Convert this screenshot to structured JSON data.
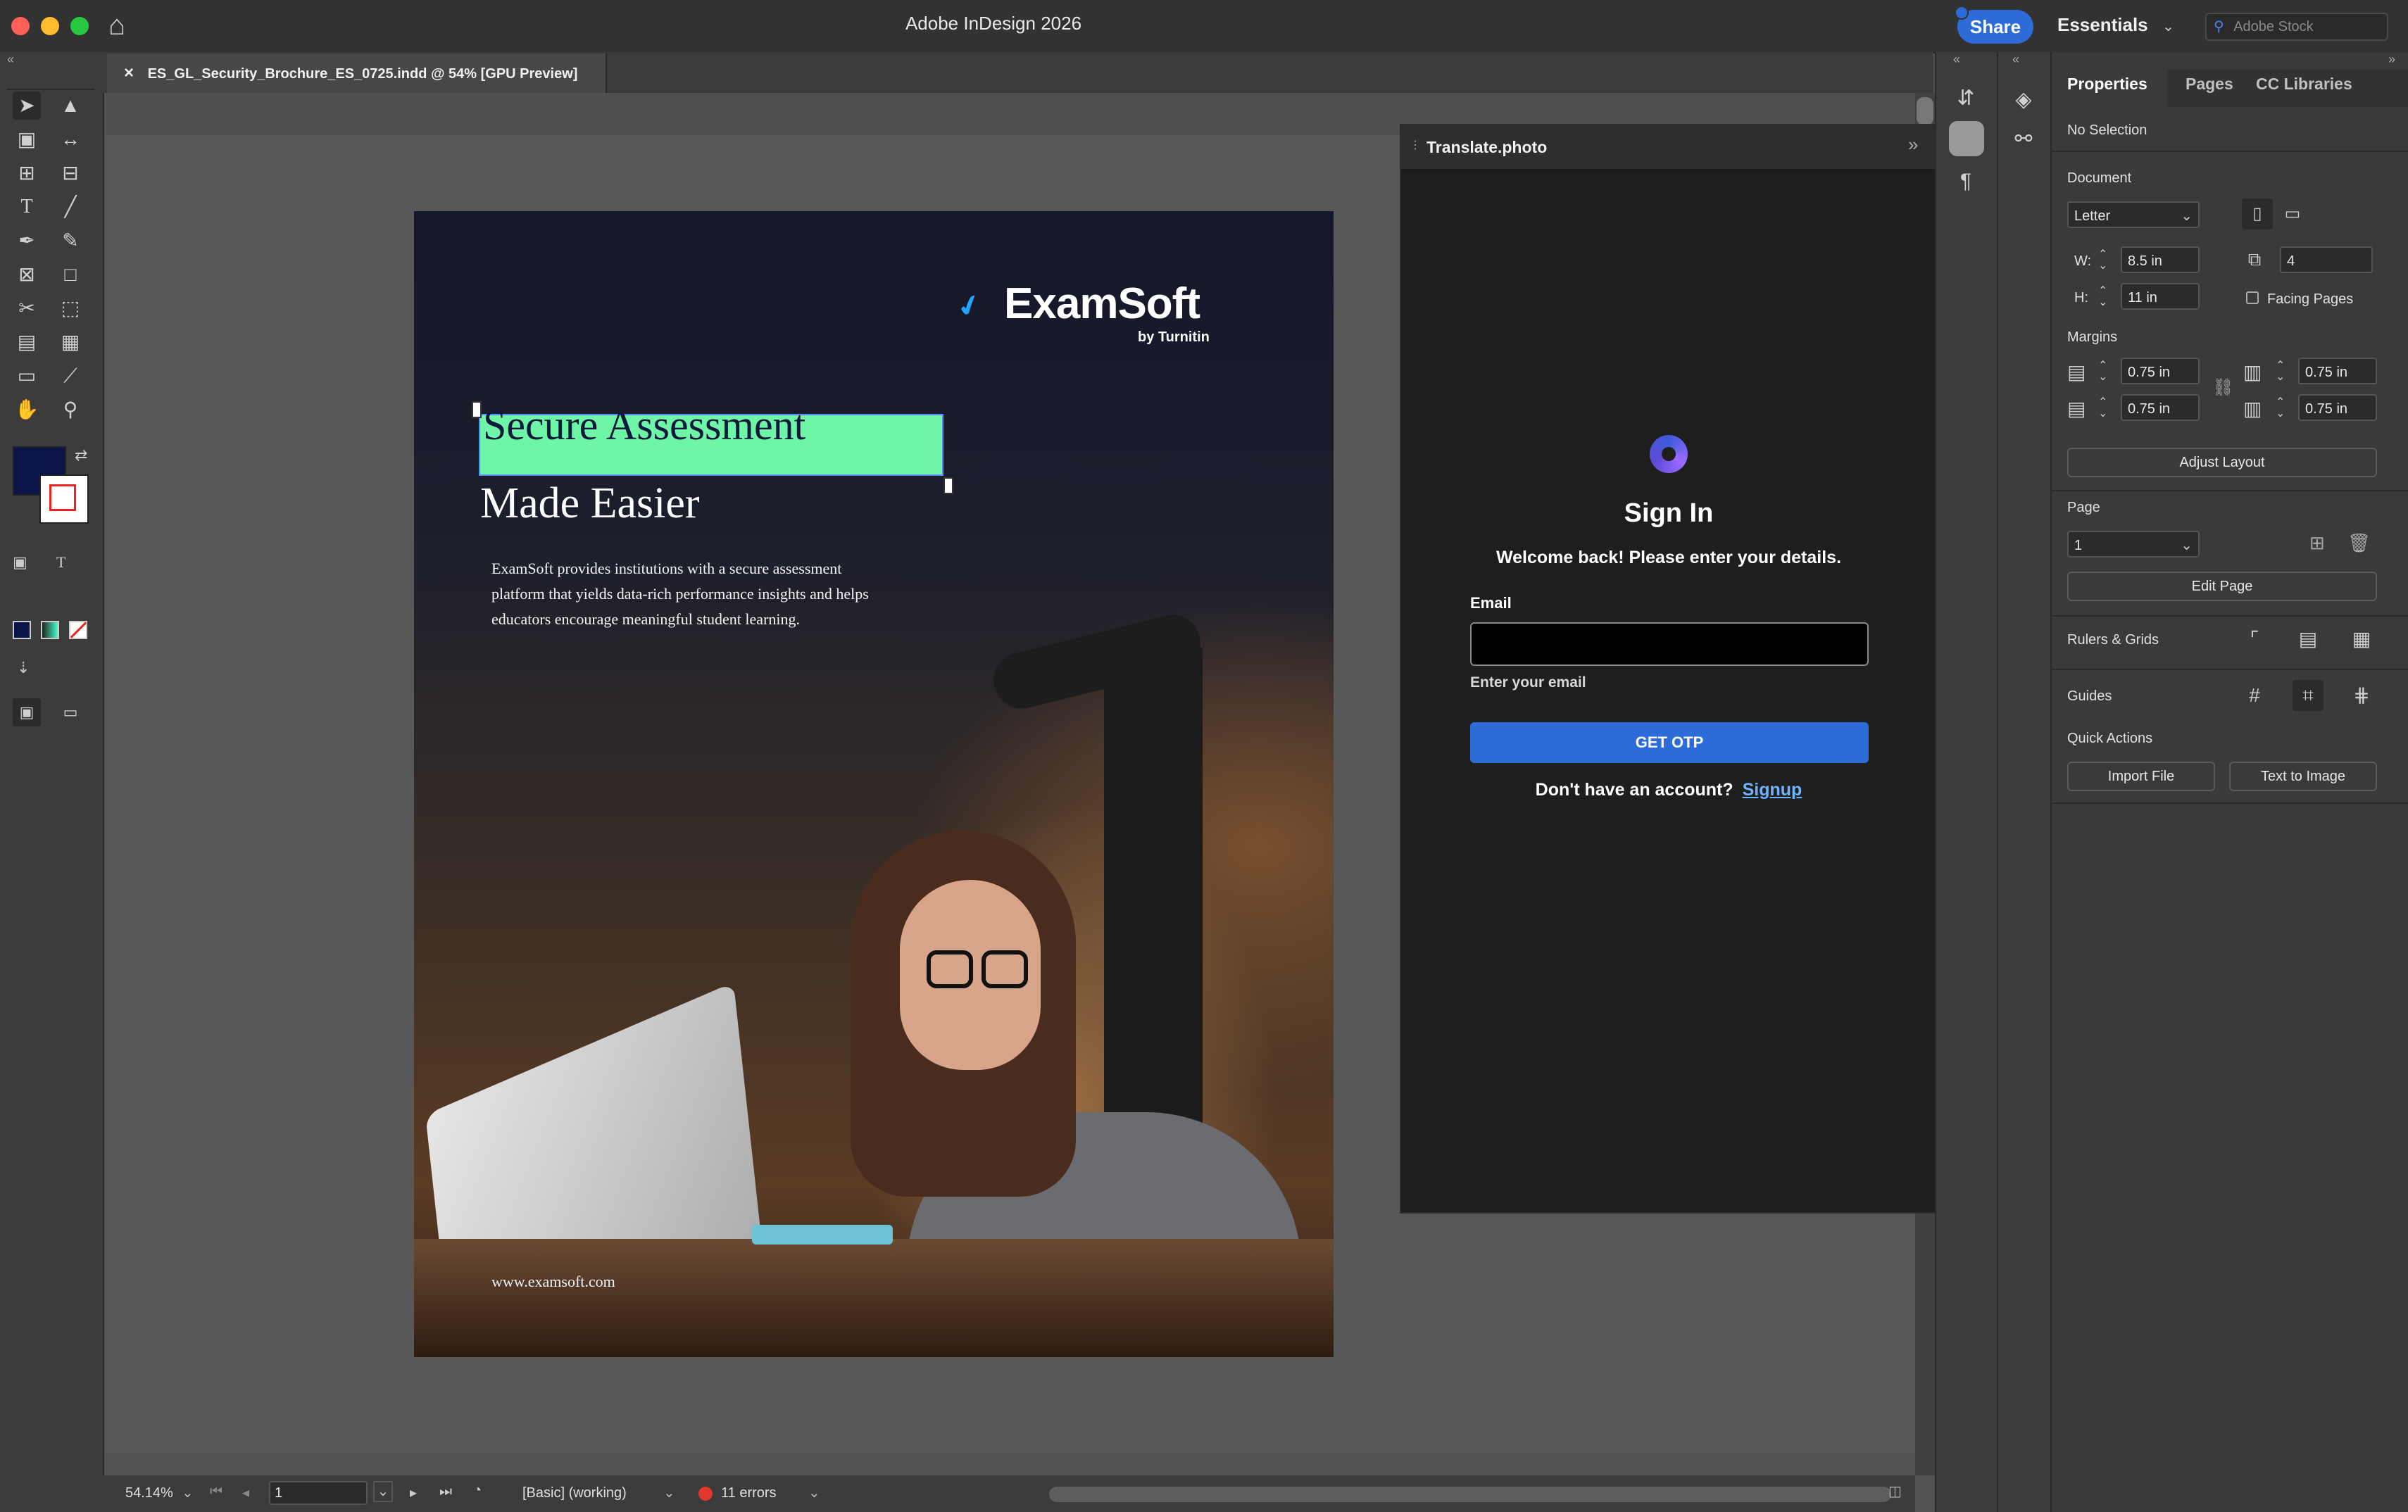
{
  "titlebar": {
    "app_title": "Adobe InDesign 2026",
    "share_label": "Share",
    "workspace": "Essentials",
    "search_placeholder": "Adobe Stock"
  },
  "document_tab": {
    "close_glyph": "×",
    "title": "ES_GL_Security_Brochure_ES_0725.indd @ 54% [GPU Preview]"
  },
  "page": {
    "logo_name": "ExamSoft",
    "logo_byline": "by Turnitin",
    "headline_line1": "Secure Assessment",
    "headline_line2": "Made Easier",
    "body_text": "ExamSoft provides institutions with a secure assessment platform that yields data-rich performance insights and helps educators encourage meaningful student learning.",
    "url": "www.examsoft.com",
    "highlight_color": "#6ef5a8"
  },
  "translate_panel": {
    "title": "Translate.photo",
    "heading": "Sign In",
    "subheading": "Welcome back! Please enter your details.",
    "email_label": "Email",
    "email_value": "",
    "email_hint": "Enter your email",
    "otp_button": "GET OTP",
    "signup_prompt": "Don't have an account?",
    "signup_link": "Signup",
    "accent": "#2d6cd8"
  },
  "properties": {
    "tabs": [
      "Properties",
      "Pages",
      "CC Libraries"
    ],
    "selection_status": "No Selection",
    "document_section": "Document",
    "page_size": "Letter",
    "width_label": "W:",
    "width_value": "8.5 in",
    "height_label": "H:",
    "height_value": "11 in",
    "pages_count": "4",
    "facing_pages_label": "Facing Pages",
    "margins_section": "Margins",
    "margin_top": "0.75 in",
    "margin_bottom": "0.75 in",
    "margin_left": "0.75 in",
    "margin_right": "0.75 in",
    "adjust_layout": "Adjust Layout",
    "page_section": "Page",
    "page_value": "1",
    "edit_page": "Edit Page",
    "rulers_grids": "Rulers & Grids",
    "guides": "Guides",
    "quick_actions": "Quick Actions",
    "import_file": "Import File",
    "text_to_image": "Text to Image"
  },
  "statusbar": {
    "zoom": "54.14%",
    "page_number": "1",
    "preflight_profile": "[Basic] (working)",
    "errors": "11 errors",
    "error_color": "#e0362b"
  },
  "icons": {
    "home": "⌂",
    "pilcrow": "¶",
    "collapse": "«",
    "expand": "»"
  }
}
